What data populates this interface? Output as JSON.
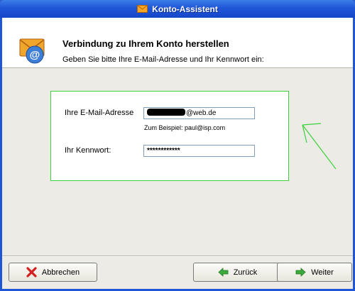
{
  "window": {
    "title": "Konto-Assistent",
    "title_icon": "envelope-icon"
  },
  "header": {
    "icon": "email-at-envelope-icon",
    "title": "Verbindung zu Ihrem Konto herstellen",
    "subtitle": "Geben Sie bitte Ihre E-Mail-Adresse und Ihr Kennwort ein:"
  },
  "form": {
    "email_label": "Ihre E-Mail-Adresse",
    "email_value_visible": "@web.de",
    "email_example": "Zum Beispiel: paul@isp.com",
    "password_label": "Ihr Kennwort:",
    "password_value": "************"
  },
  "buttons": {
    "cancel": "Abbrechen",
    "back": "Zurück",
    "next": "Weiter"
  },
  "colors": {
    "annotation_green": "#3ad23a",
    "titlebar_blue": "#1f56d8"
  }
}
